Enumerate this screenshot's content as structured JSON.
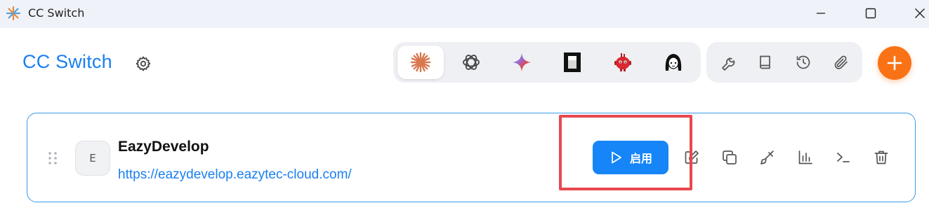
{
  "window": {
    "title": "CC Switch",
    "controls": [
      "minimize-icon",
      "maximize-icon",
      "close-icon"
    ]
  },
  "header": {
    "brand": "CC Switch",
    "settings_icon": "gear-icon",
    "apps": [
      {
        "id": "claude",
        "icon": "claude-starburst-icon",
        "active": true
      },
      {
        "id": "openai",
        "icon": "openai-knot-icon",
        "active": false
      },
      {
        "id": "gemini",
        "icon": "gemini-sparkle-icon",
        "active": false
      },
      {
        "id": "black-square",
        "icon": "black-square-app-icon",
        "active": false
      },
      {
        "id": "red-robot",
        "icon": "red-robot-icon",
        "active": false
      },
      {
        "id": "character",
        "icon": "anime-character-icon",
        "active": false
      }
    ],
    "tools": [
      "wrench-icon",
      "book-icon",
      "history-icon",
      "paperclip-icon"
    ],
    "add_icon": "plus-icon"
  },
  "provider": {
    "avatar_letter": "E",
    "name": "EazyDevelop",
    "url": "https://eazydevelop.eazytec-cloud.com/",
    "enable_label": "启用",
    "actions": [
      "edit-icon",
      "copy-icon",
      "brush-icon",
      "stats-icon",
      "terminal-icon",
      "delete-icon"
    ]
  },
  "colors": {
    "brand": "#1a7ff0",
    "accent": "#1585f8",
    "add": "#f97316",
    "highlight": "#e8484f"
  }
}
